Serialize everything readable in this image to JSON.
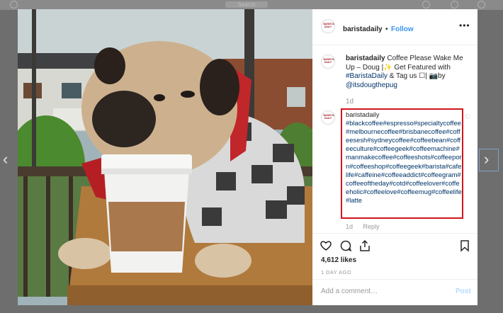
{
  "topbar": {
    "search_placeholder": "Search"
  },
  "nav": {
    "prev_glyph": "‹",
    "next_glyph": "›"
  },
  "post": {
    "username": "baristadaily",
    "separator": "•",
    "follow_label": "Follow",
    "more_glyph": "•••",
    "avatar_logo": "BARISTA DAILY",
    "caption_text": "Coffee Please Wake Me Up – Doug |✨ Get Featured with",
    "caption_tag": "#BaristaDaily",
    "caption_middle": "& Tag us ☐|",
    "caption_camera": "📷by",
    "caption_mention": "@itsdougthepug",
    "caption_time": "1d",
    "comment_hashtags": "#blackcoffee#espresso#specialtycoffee#melbournecoffee#brisbanecoffee#coffeesesh#sydneycoffee#coffeebean#coffeeculture#coffeegeek#coffeemachine#manmakecoffee#coffeeshots#coffeeporn#coffeeshop#coffeegeek#barista#cafelife#caffeine#coffeeaddict#coffeegram#coffeeoftheday#cotd#coffeelover#coffeeholic#coffeelove#coffeemug#coffeelife#latte",
    "comment_time": "1d",
    "reply_label": "Reply",
    "likes": "4,612 likes",
    "posted_ago": "1 DAY AGO",
    "comment_placeholder": "Add a comment…",
    "post_label": "Post"
  },
  "colors": {
    "link": "#003569",
    "follow": "#3897f0",
    "highlight_border": "#d0161c"
  }
}
